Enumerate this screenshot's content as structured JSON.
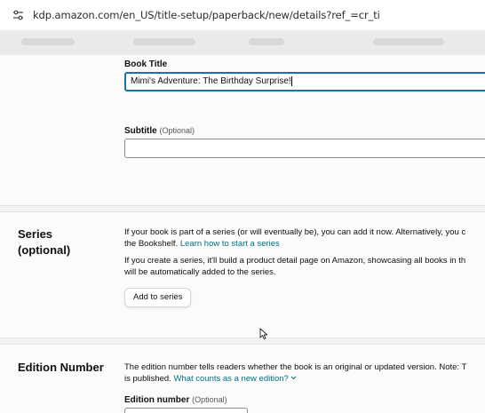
{
  "browser": {
    "url": "kdp.amazon.com/en_US/title-setup/paperback/new/details?ref_=cr_ti",
    "site_icon": "tune-icon"
  },
  "book_title": {
    "label": "Book Title",
    "value": "Mimi's Adventure: The Birthday Surprise!"
  },
  "subtitle": {
    "label": "Subtitle",
    "optional": "(Optional)",
    "value": ""
  },
  "series": {
    "title_line1": "Series",
    "title_line2": "(optional)",
    "para1_line1": "If your book is part of a series (or will eventually be), you can add it now. Alternatively, you c",
    "para1_line2_pre": "the Bookshelf.",
    "para1_link": "Learn how to start a series",
    "para2_line1": "If you create a series, it'll build a product detail page on Amazon, showcasing all books in th",
    "para2_line2": "will be automatically added to the series.",
    "button": "Add to series"
  },
  "edition": {
    "title": "Edition Number",
    "text_line1": "The edition number tells readers whether the book is an original or updated version. Note: T",
    "text_line2_pre": "is published.",
    "link": "What counts as a new edition?",
    "label": "Edition number",
    "optional": "(Optional)"
  },
  "colors": {
    "link": "#007185",
    "focus": "#1a73a8"
  }
}
